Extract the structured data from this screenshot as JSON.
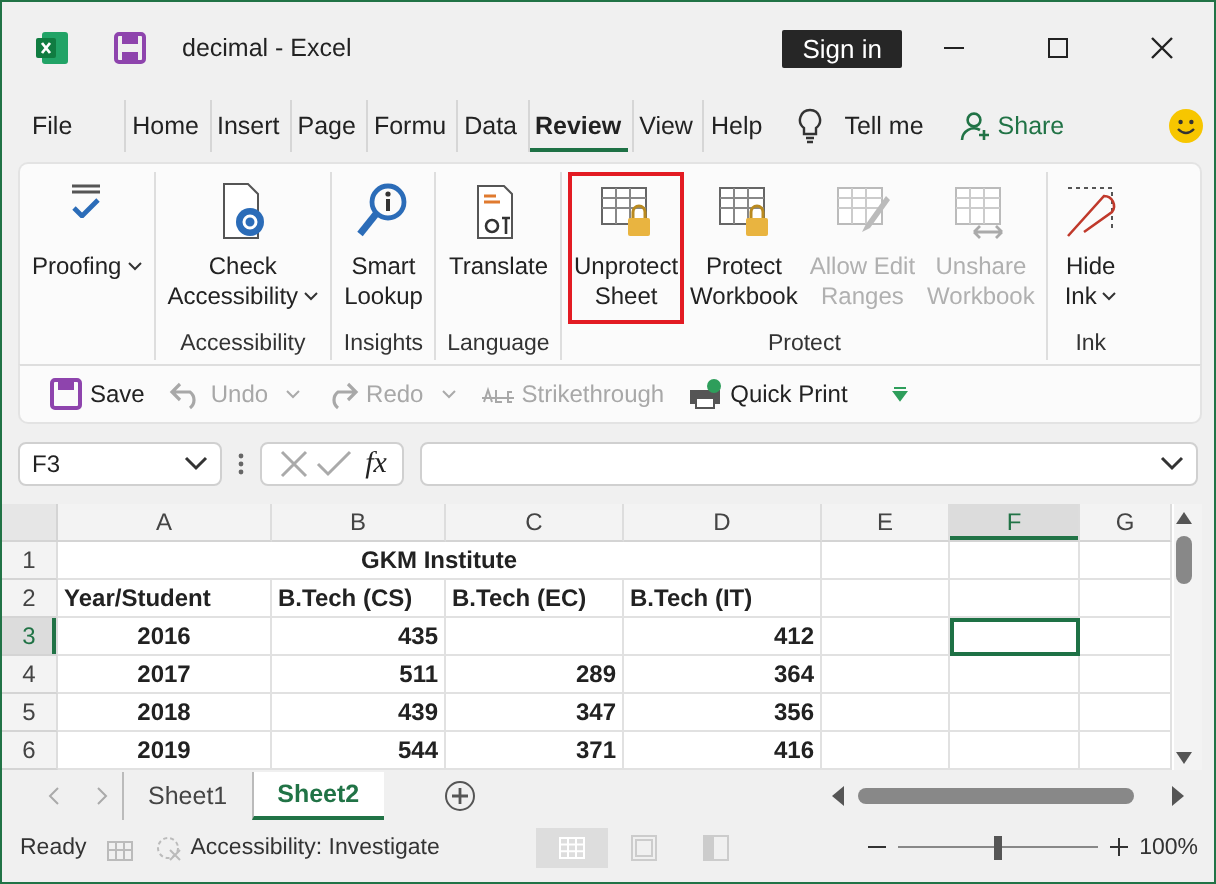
{
  "window": {
    "file_name": "decimal  -  Excel",
    "sign_in": "Sign in"
  },
  "tabs": [
    {
      "label": "File",
      "selected": false
    },
    {
      "label": "Home",
      "selected": false
    },
    {
      "label": "Insert",
      "selected": false
    },
    {
      "label": "Page",
      "selected": false
    },
    {
      "label": "Formu",
      "selected": false
    },
    {
      "label": "Data",
      "selected": false
    },
    {
      "label": "Review",
      "selected": true
    },
    {
      "label": "View",
      "selected": false
    },
    {
      "label": "Help",
      "selected": false
    }
  ],
  "tell_me": "Tell me",
  "share": "Share",
  "ribbon": [
    {
      "buttons": [
        {
          "kind": "proofing",
          "lines": [
            "Proofing"
          ],
          "dropdown": true,
          "disabled": false,
          "highlighted": false
        }
      ]
    },
    {
      "label": "Accessibility",
      "buttons": [
        {
          "kind": "accessibility",
          "lines": [
            "Check",
            "Accessibility"
          ],
          "dropdown": true,
          "disabled": false,
          "highlighted": false
        }
      ]
    },
    {
      "label": "Insights",
      "buttons": [
        {
          "kind": "lookup",
          "lines": [
            "Smart",
            "Lookup"
          ],
          "dropdown": false,
          "disabled": false,
          "highlighted": false
        }
      ]
    },
    {
      "label": "Language",
      "buttons": [
        {
          "kind": "translate",
          "lines": [
            "Translate"
          ],
          "dropdown": false,
          "disabled": false,
          "highlighted": false
        }
      ]
    },
    {
      "label": "Protect",
      "buttons": [
        {
          "kind": "unprotect",
          "lines": [
            "Unprotect",
            "Sheet"
          ],
          "dropdown": false,
          "disabled": false,
          "highlighted": true
        },
        {
          "kind": "protect",
          "lines": [
            "Protect",
            "Workbook"
          ],
          "dropdown": false,
          "disabled": false,
          "highlighted": false
        },
        {
          "kind": "allow",
          "lines": [
            "Allow Edit",
            "Ranges"
          ],
          "dropdown": false,
          "disabled": true,
          "highlighted": false
        },
        {
          "kind": "unshare",
          "lines": [
            "Unshare",
            "Workbook"
          ],
          "dropdown": false,
          "disabled": true,
          "highlighted": false
        }
      ]
    },
    {
      "label": "Ink",
      "buttons": [
        {
          "kind": "ink",
          "lines": [
            "Hide",
            "Ink"
          ],
          "dropdown": true,
          "disabled": false,
          "highlighted": false
        }
      ]
    }
  ],
  "quick_access": [
    {
      "kind": "save",
      "label": "Save",
      "disabled": false,
      "dropdown": false
    },
    {
      "kind": "undo",
      "label": "Undo",
      "disabled": true,
      "dropdown": true
    },
    {
      "kind": "redo",
      "label": "Redo",
      "disabled": true,
      "dropdown": true
    },
    {
      "kind": "strike",
      "label": "Strikethrough",
      "disabled": true,
      "dropdown": false
    },
    {
      "kind": "print",
      "label": "Quick Print",
      "disabled": false,
      "dropdown": false
    }
  ],
  "name_box": "F3",
  "formula_label": "fx",
  "columns": [
    {
      "label": "A",
      "selected": false
    },
    {
      "label": "B",
      "selected": false
    },
    {
      "label": "C",
      "selected": false
    },
    {
      "label": "D",
      "selected": false
    },
    {
      "label": "E",
      "selected": false
    },
    {
      "label": "F",
      "selected": true
    },
    {
      "label": "G",
      "selected": false
    }
  ],
  "rows": [
    {
      "header": "1",
      "selected": false,
      "kind": "title",
      "title": "GKM Institute"
    },
    {
      "header": "2",
      "selected": false,
      "kind": "header",
      "cells": [
        "Year/Student",
        "B.Tech (CS)",
        "B.Tech (EC)",
        "B.Tech (IT)"
      ]
    },
    {
      "header": "3",
      "selected": true,
      "kind": "data",
      "cells": [
        "2016",
        "435",
        null,
        "412"
      ]
    },
    {
      "header": "4",
      "selected": false,
      "kind": "data",
      "cells": [
        "2017",
        "511",
        "289",
        "364"
      ]
    },
    {
      "header": "5",
      "selected": false,
      "kind": "data",
      "cells": [
        "2018",
        "439",
        "347",
        "356"
      ]
    },
    {
      "header": "6",
      "selected": false,
      "kind": "data",
      "cells": [
        "2019",
        "544",
        "371",
        "416"
      ]
    }
  ],
  "sheets": [
    {
      "label": "Sheet1",
      "selected": false
    },
    {
      "label": "Sheet2",
      "selected": true
    }
  ],
  "status": {
    "ready": "Ready",
    "accessibility": "Accessibility: Investigate",
    "zoom": {
      "level": 0.5,
      "reading": "100%"
    }
  }
}
